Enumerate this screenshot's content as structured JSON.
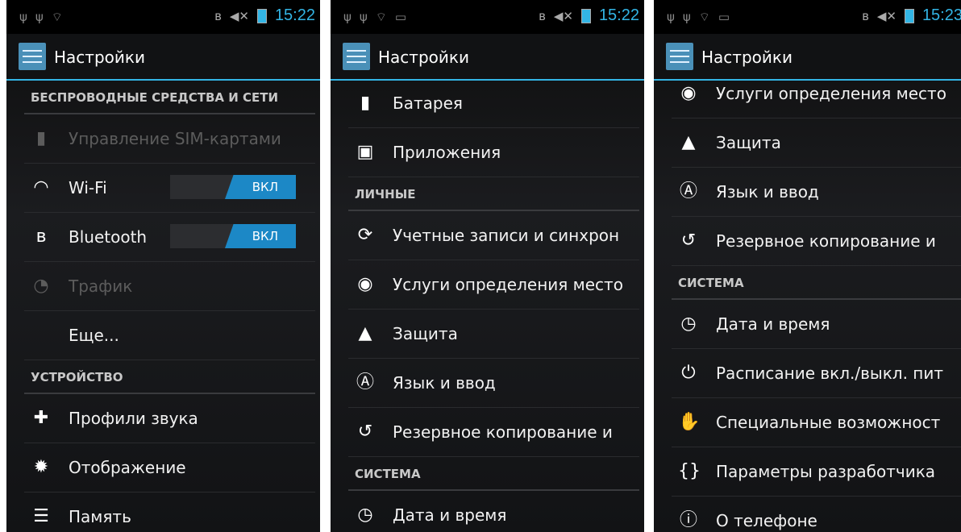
{
  "statusbar": {
    "time1": "15:22",
    "time2": "15:22",
    "time3": "15:23"
  },
  "app": {
    "title": "Настройки"
  },
  "p1": {
    "header_wireless": "БЕСПРОВОДНЫЕ СРЕДСТВА И СЕТИ",
    "sim": "Управление SIM-картами",
    "wifi": "Wi-Fi",
    "wifi_toggle": "ВКЛ",
    "bluetooth": "Bluetooth",
    "bt_toggle": "ВКЛ",
    "traffic": "Трафик",
    "more": "Еще...",
    "header_device": "УСТРОЙСТВО",
    "sound": "Профили звука",
    "display": "Отображение",
    "memory": "Память"
  },
  "p2": {
    "battery": "Батарея",
    "apps": "Приложения",
    "header_personal": "ЛИЧНЫЕ",
    "accounts": "Учетные записи и синхрон",
    "location": "Услуги определения место",
    "security": "Защита",
    "language": "Язык и ввод",
    "backup": "Резервное копирование и",
    "header_system": "СИСТЕМА",
    "datetime": "Дата и время"
  },
  "p3": {
    "location": "Услуги определения место",
    "security": "Защита",
    "language": "Язык и ввод",
    "backup": "Резервное копирование и",
    "header_system": "СИСТЕМА",
    "datetime": "Дата и время",
    "schedule": "Расписание вкл./выкл. пит",
    "accessibility": "Специальные возможност",
    "developer": "Параметры разработчика",
    "about": "О телефоне"
  },
  "colors": {
    "accent": "#33b5e5",
    "toggle_on": "#1c88c6",
    "background": "#1b1c1f"
  }
}
